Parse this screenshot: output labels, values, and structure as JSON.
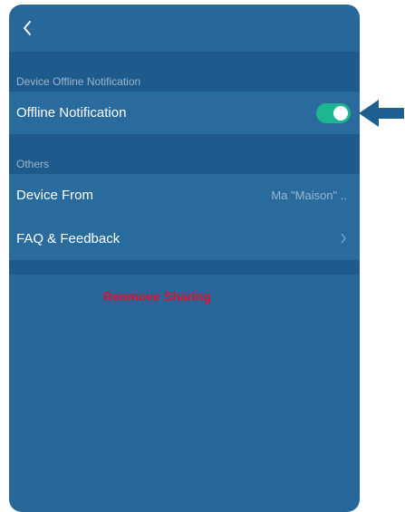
{
  "header": {
    "back_icon": "chevron-left-icon"
  },
  "sections": {
    "offline": {
      "header": "Device Offline Notification",
      "row_label": "Offline Notification",
      "toggle_on": true
    },
    "others": {
      "header": "Others",
      "device_from_label": "Device From",
      "device_from_value": "Ma \"Maison\" ..",
      "faq_label": "FAQ & Feedback"
    }
  },
  "actions": {
    "remove_label": "Renmove Sharing"
  },
  "colors": {
    "background": "#27679a",
    "section_header": "#1e5a8c",
    "toggle": "#1cb68f",
    "danger": "#e0102a",
    "annotation_arrow": "#1f5f8f"
  }
}
